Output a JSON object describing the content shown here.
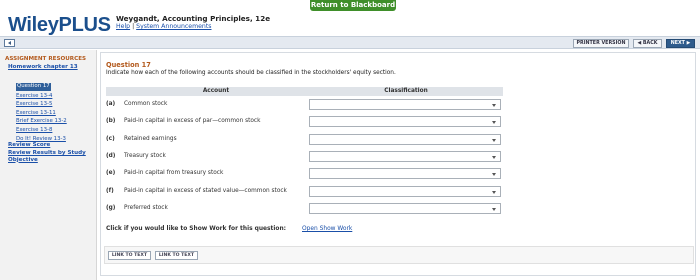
{
  "return_button": "Return to Blackboard",
  "header": {
    "logo": "WileyPLUS",
    "book_title": "Weygandt, Accounting Principles, 12e",
    "help_link": "Help",
    "separator": "|",
    "announcements_link": "System Announcements"
  },
  "toolbar": {
    "printer_version": "PRINTER VERSION",
    "back": "◀ BACK",
    "next": "NEXT ▶"
  },
  "sidebar": {
    "heading": "ASSIGNMENT RESOURCES",
    "homework_title": "Homework chapter 13",
    "items": [
      {
        "label": "Question 17",
        "active": true
      },
      {
        "label": "Exercise 13-4",
        "active": false
      },
      {
        "label": "Exercise 13-5",
        "active": false
      },
      {
        "label": "Exercise 13-11",
        "active": false
      },
      {
        "label": "Brief Exercise 13-2",
        "active": false
      },
      {
        "label": "Exercise 13-8",
        "active": false
      },
      {
        "label": "Do It! Review 13-3",
        "active": false
      }
    ],
    "review_score": "Review Score",
    "review_results_line1": "Review Results by Study",
    "review_results_line2": "Objective"
  },
  "question": {
    "title": "Question 17",
    "text": "Indicate how each of the following accounts should be classified in the stockholders' equity section.",
    "col_account": "Account",
    "col_classification": "Classification",
    "rows": [
      {
        "letter": "(a)",
        "account": "Common stock",
        "value": ""
      },
      {
        "letter": "(b)",
        "account": "Paid-in capital in excess of par—common stock",
        "value": ""
      },
      {
        "letter": "(c)",
        "account": "Retained earnings",
        "value": ""
      },
      {
        "letter": "(d)",
        "account": "Treasury stock",
        "value": ""
      },
      {
        "letter": "(e)",
        "account": "Paid-in capital from treasury stock",
        "value": ""
      },
      {
        "letter": "(f)",
        "account": "Paid-in capital in excess of stated value—common stock",
        "value": ""
      },
      {
        "letter": "(g)",
        "account": "Preferred stock",
        "value": ""
      }
    ],
    "show_work_prompt": "Click if you would like to Show Work for this question:",
    "show_work_link": "Open Show Work"
  },
  "bottom_links": [
    "LINK TO TEXT",
    "LINK TO TEXT"
  ]
}
